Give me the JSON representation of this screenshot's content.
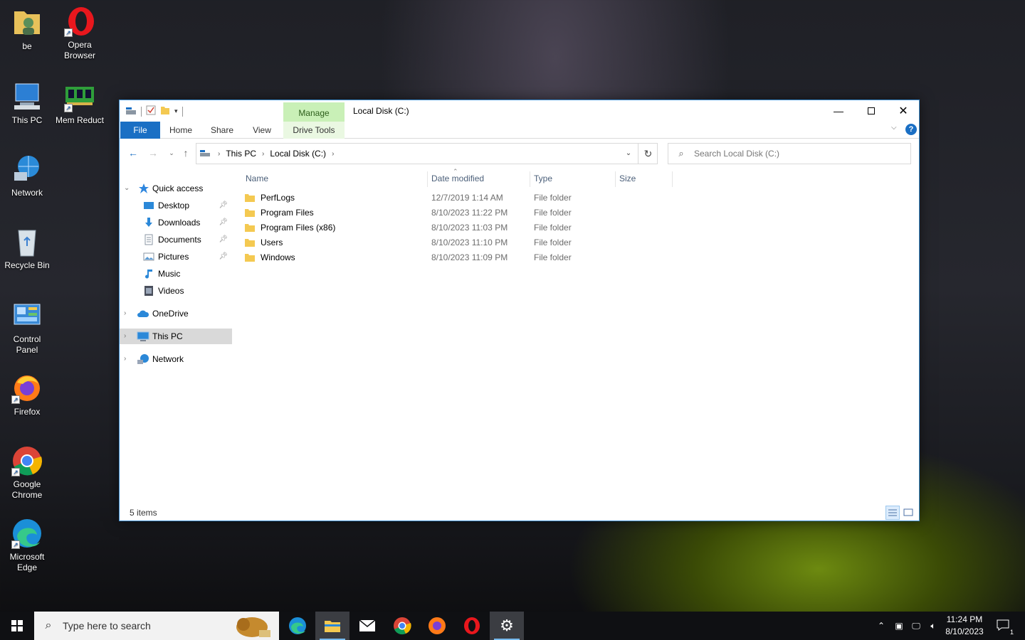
{
  "desktop": {
    "icons": [
      {
        "label": "be"
      },
      {
        "label": "Opera Browser"
      },
      {
        "label": "This PC"
      },
      {
        "label": "Mem Reduct"
      },
      {
        "label": "Network"
      },
      {
        "label": "Recycle Bin"
      },
      {
        "label": "Control Panel"
      },
      {
        "label": "Firefox"
      },
      {
        "label": "Google Chrome"
      },
      {
        "label": "Microsoft Edge"
      }
    ]
  },
  "window": {
    "title": "Local Disk (C:)",
    "context_tab": "Manage",
    "ribbon_tabs": [
      "File",
      "Home",
      "Share",
      "View",
      "Drive Tools"
    ],
    "breadcrumb": [
      "This PC",
      "Local Disk (C:)"
    ],
    "search_placeholder": "Search Local Disk (C:)",
    "nav": {
      "quick_access": "Quick access",
      "quick_items": [
        {
          "label": "Desktop",
          "pinned": true
        },
        {
          "label": "Downloads",
          "pinned": true
        },
        {
          "label": "Documents",
          "pinned": true
        },
        {
          "label": "Pictures",
          "pinned": true
        },
        {
          "label": "Music",
          "pinned": false
        },
        {
          "label": "Videos",
          "pinned": false
        }
      ],
      "onedrive": "OneDrive",
      "this_pc": "This PC",
      "network": "Network"
    },
    "columns": {
      "name": "Name",
      "date": "Date modified",
      "type": "Type",
      "size": "Size"
    },
    "files": [
      {
        "name": "PerfLogs",
        "date": "12/7/2019 1:14 AM",
        "type": "File folder"
      },
      {
        "name": "Program Files",
        "date": "8/10/2023 11:22 PM",
        "type": "File folder"
      },
      {
        "name": "Program Files (x86)",
        "date": "8/10/2023 11:03 PM",
        "type": "File folder"
      },
      {
        "name": "Users",
        "date": "8/10/2023 11:10 PM",
        "type": "File folder"
      },
      {
        "name": "Windows",
        "date": "8/10/2023 11:09 PM",
        "type": "File folder"
      }
    ],
    "status": "5 items"
  },
  "taskbar": {
    "search_placeholder": "Type here to search",
    "time": "11:24 PM",
    "date": "8/10/2023",
    "notification_count": "1"
  },
  "colors": {
    "accent": "#1a6fc4",
    "manage_tab": "#c9f0b7",
    "folder": "#f4c951"
  }
}
